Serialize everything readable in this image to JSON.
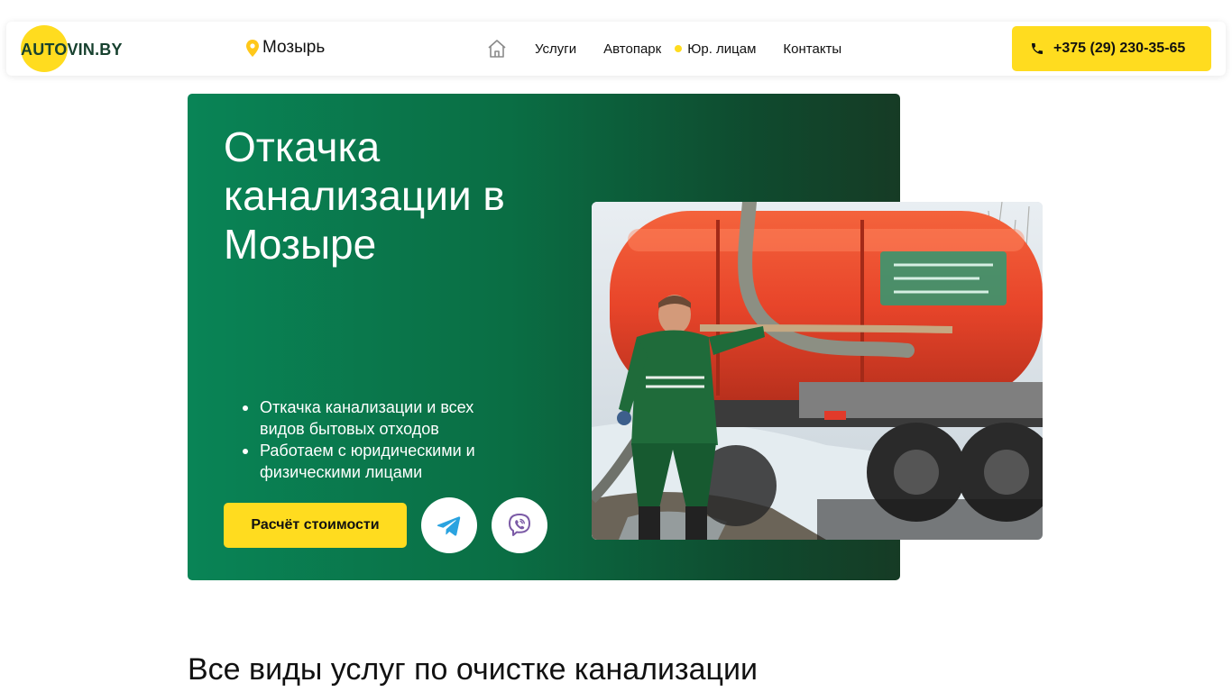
{
  "header": {
    "logo_text": "AUTOVIN.BY",
    "city": "Мозырь",
    "nav": [
      {
        "label": "Услуги"
      },
      {
        "label": "Автопарк"
      },
      {
        "label": "Юр. лицам"
      },
      {
        "label": "Контакты"
      }
    ],
    "phone": "+375 (29) 230-35-65"
  },
  "hero": {
    "title": "Откачка канализации в Мозыре",
    "bullets": [
      "Откачка канализации и всех видов бытовых отходов",
      "Работаем с юридическими и физическими лицами"
    ],
    "calc_button": "Расчёт стоимости"
  },
  "section": {
    "title": "Все виды услуг по очистке канализации"
  },
  "colors": {
    "accent": "#ffdc1f",
    "hero_green": "#098456",
    "hero_dark": "#163b25",
    "truck_orange": "#e8452a"
  },
  "icons": {
    "pin": "map-pin-icon",
    "home": "home-icon",
    "phone": "phone-icon",
    "telegram": "telegram-icon",
    "viber": "viber-icon"
  }
}
